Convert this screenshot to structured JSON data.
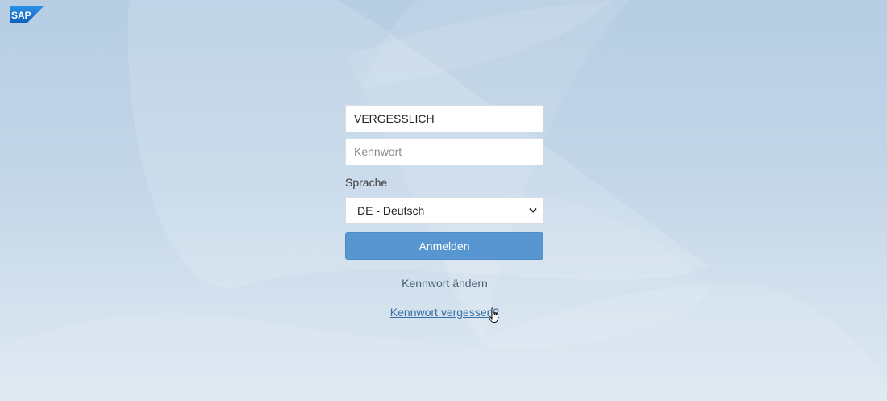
{
  "logo": {
    "text": "SAP",
    "color": "#1a73c8"
  },
  "login": {
    "username_value": "VERGESSLICH",
    "password_placeholder": "Kennwort",
    "language_label": "Sprache",
    "language_selected": "DE - Deutsch",
    "submit_label": "Anmelden",
    "change_password_label": "Kennwort ändern",
    "forgot_password_label": "Kennwort vergessen?"
  },
  "colors": {
    "button": "#5896d1",
    "link": "#3a6ea8"
  },
  "cursor": {
    "icon": "hand-pointer-icon"
  }
}
